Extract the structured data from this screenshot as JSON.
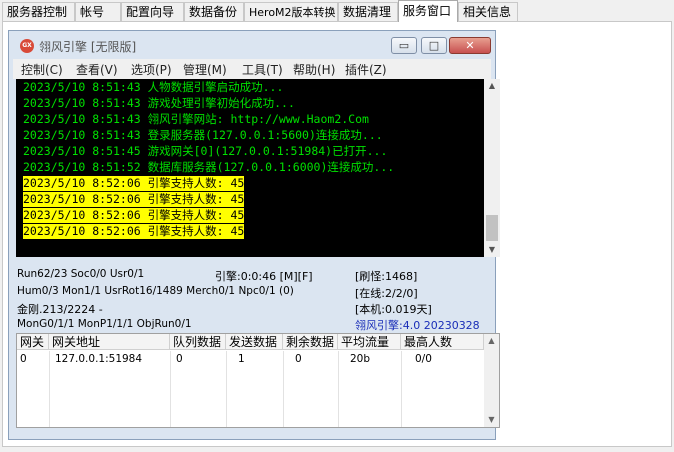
{
  "tabs": [
    "服务器控制",
    "帐号",
    "配置向导",
    "数据备份",
    "HeroM2版本转换",
    "数据清理",
    "服务窗口",
    "相关信息"
  ],
  "window": {
    "icon_text": "GX",
    "title": "翎风引擎 [无限版]",
    "minimize": "▭",
    "maximize": "□",
    "close": "✕"
  },
  "menu": [
    "控制(C)",
    "查看(V)",
    "选项(P)",
    "管理(M)",
    "工具(T)",
    "帮助(H)",
    "插件(Z)"
  ],
  "console_lines": [
    {
      "text": "2023/5/10 8:51:43 人物数据引擎启动成功...",
      "hl": false
    },
    {
      "text": "2023/5/10 8:51:43 游戏处理引擎初始化成功...",
      "hl": false
    },
    {
      "text": "2023/5/10 8:51:43 翎风引擎网站: http://www.Haom2.Com",
      "hl": false
    },
    {
      "text": "2023/5/10 8:51:43 登录服务器(127.0.0.1:5600)连接成功...",
      "hl": false
    },
    {
      "text": "2023/5/10 8:51:45 游戏网关[0](127.0.0.1:51984)已打开...",
      "hl": false
    },
    {
      "text": "2023/5/10 8:51:52 数据库服务器(127.0.0.1:6000)连接成功...",
      "hl": false
    },
    {
      "text": "2023/5/10 8:52:06 引擎支持人数: 45",
      "hl": true
    },
    {
      "text": "2023/5/10 8:52:06 引擎支持人数: 45",
      "hl": true
    },
    {
      "text": "2023/5/10 8:52:06 引擎支持人数: 45",
      "hl": true
    },
    {
      "text": "2023/5/10 8:52:06 引擎支持人数: 45",
      "hl": true
    }
  ],
  "info": {
    "run": "Run62/23 Soc0/0 Usr0/1",
    "engine_time": "引擎:0:0:46 [M][F]",
    "refresh": "[刷怪:1468]",
    "hum": "Hum0/3 Mon1/1 UsrRot16/1489 Merch0/1 Npc0/1 (0)",
    "online": "[在线:2/2/0]",
    "jingang": "金刚.213/2224 -",
    "local": "[本机:0.019天]",
    "mon": "MonG0/1/1 MonP1/1/1 ObjRun0/1",
    "version": "翎风引擎:4.0 20230328",
    "version_color": "#1a2eb8"
  },
  "grid": {
    "headers": [
      "网关",
      "网关地址",
      "队列数据",
      "发送数据",
      "剩余数据",
      "平均流量",
      "最高人数"
    ],
    "rows": [
      [
        "0",
        "127.0.0.1:51984",
        "0",
        "1",
        "0",
        "20b",
        "0/0"
      ]
    ]
  }
}
